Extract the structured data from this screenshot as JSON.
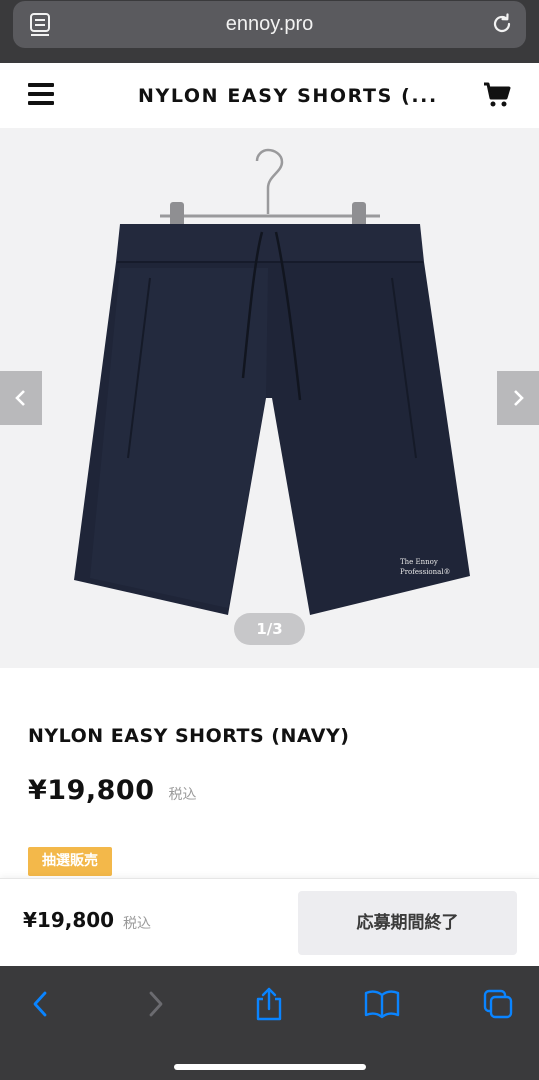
{
  "browser": {
    "url": "ennoy.pro",
    "reader_icon": "reader-icon",
    "reload_icon": "reload-icon",
    "accent_color": "#0a84ff"
  },
  "header": {
    "title": "NYLON EASY SHORTS (...",
    "menu_icon": "hamburger-menu-icon",
    "cart_icon": "cart-icon"
  },
  "gallery": {
    "counter": "1/3",
    "prev_icon": "chevron-left-icon",
    "next_icon": "chevron-right-icon",
    "garment_label_line1": "The Ennoy",
    "garment_label_line2": "Professional®"
  },
  "product": {
    "name": "NYLON EASY SHORTS (NAVY)",
    "price": "¥19,800",
    "tax_label": "税込",
    "badge": "抽選販売",
    "badge_color": "#f3b84a"
  },
  "buy_bar": {
    "price": "¥19,800",
    "tax_label": "税込",
    "button_label": "応募期間終了"
  },
  "toolbar": {
    "back_icon": "back-icon",
    "forward_icon": "forward-icon",
    "share_icon": "share-icon",
    "bookmarks_icon": "bookmarks-icon",
    "tabs_icon": "tabs-icon"
  }
}
